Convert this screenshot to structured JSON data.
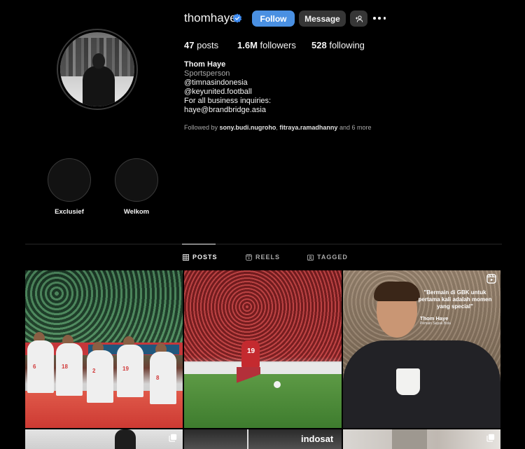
{
  "profile": {
    "username": "thomhaye",
    "verified": true,
    "follow_label": "Follow",
    "message_label": "Message",
    "suggest_icon": "add-person-icon",
    "more_icon": "more-horizontal-icon"
  },
  "stats": {
    "posts_count": "47",
    "posts_label": "posts",
    "followers_count": "1.6M",
    "followers_label": "followers",
    "following_count": "528",
    "following_label": "following"
  },
  "bio": {
    "name": "Thom Haye",
    "category": "Sportsperson",
    "lines": [
      "@timnasindonesia",
      "@keyunited.football",
      "For all business inquiries:",
      "haye@brandbridge.asia"
    ]
  },
  "followed_by": {
    "prefix": "Followed by",
    "user1": "sony.budi.nugroho",
    "separator": ",",
    "user2": "fitraya.ramadhanny",
    "suffix": "and 6 more"
  },
  "highlights": [
    {
      "label": "Exclusief"
    },
    {
      "label": "Welkom"
    }
  ],
  "tabs": [
    {
      "label": "POSTS",
      "icon": "grid-icon",
      "active": true
    },
    {
      "label": "REELS",
      "icon": "reels-icon",
      "active": false
    },
    {
      "label": "TAGGED",
      "icon": "tagged-icon",
      "active": false
    }
  ],
  "posts": [
    {
      "jersey_numbers": [
        "6",
        "18",
        "2",
        "19",
        "8"
      ]
    },
    {
      "jersey_number": "19"
    },
    {
      "quote": "\"Bermain di GBK untuk pertama kali adalah momen yang special\"",
      "quote_name": "Thom Haye",
      "quote_sub": "Pemain Sepak Bola"
    },
    {},
    {
      "brand_text": "indosat"
    },
    {}
  ],
  "colors": {
    "accent": "#4a90e2",
    "button_secondary": "#363636",
    "muted_text": "#a8a8a8",
    "background": "#000000"
  }
}
